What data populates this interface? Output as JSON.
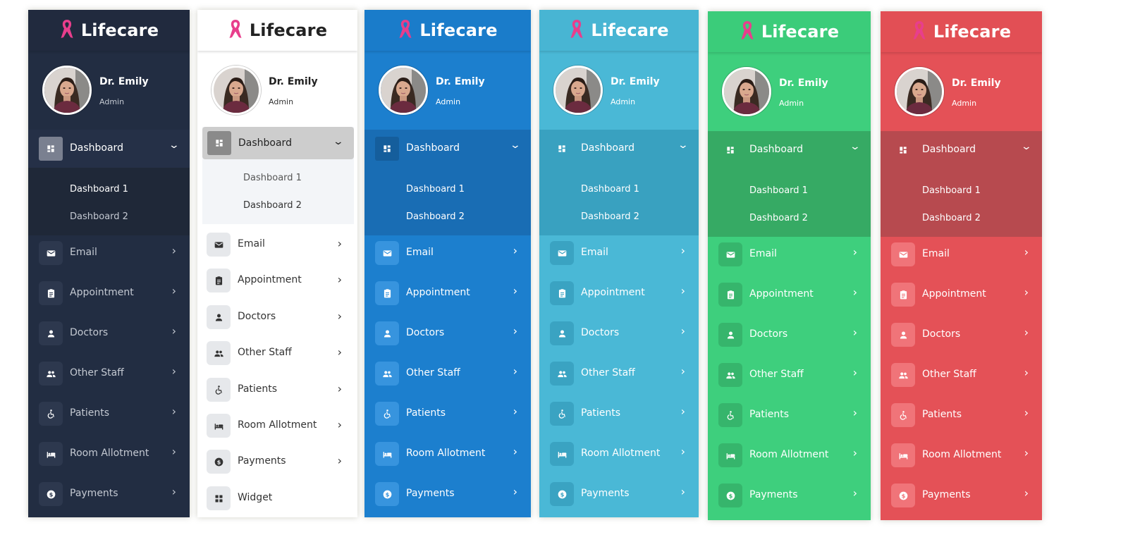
{
  "brand": "Lifecare",
  "user": {
    "name": "Dr. Emily",
    "role": "Admin"
  },
  "dashboard": {
    "label": "Dashboard",
    "subitems": [
      "Dashboard 1",
      "Dashboard 2"
    ]
  },
  "menu": [
    {
      "label": "Email",
      "icon": "email-icon"
    },
    {
      "label": "Appointment",
      "icon": "clipboard-icon"
    },
    {
      "label": "Doctors",
      "icon": "person-icon"
    },
    {
      "label": "Other Staff",
      "icon": "people-icon"
    },
    {
      "label": "Patients",
      "icon": "wheelchair-icon"
    },
    {
      "label": "Room Allotment",
      "icon": "bed-icon"
    },
    {
      "label": "Payments",
      "icon": "dollar-icon"
    },
    {
      "label": "Widget",
      "icon": "widget-icon"
    }
  ],
  "icons": {
    "ribbon": "ribbon-icon",
    "dashboard": "dashboard-grid-icon",
    "expand": "chevron-down-icon",
    "chevron": "chevron-right-icon"
  },
  "themes": [
    {
      "name": "dark",
      "bg": "#222d42",
      "header": "#212a3e",
      "sub": "#1f2838",
      "dashRow": "#253047",
      "dashIcon": "#7a8090",
      "iconBg": "#2d384e",
      "text": "#c4c9d2",
      "textStrong": "#ffffff",
      "brand": "#ffffff",
      "ribbon": "#e83e8c"
    },
    {
      "name": "light",
      "bg": "#ffffff",
      "header": "#ffffff",
      "sub": "#f3f5f8",
      "dashRow": "#cdcdcd",
      "dashIcon": "#8a8a8a",
      "iconBg": "#e6e8eb",
      "text": "#333333",
      "textStrong": "#222222",
      "brand": "#222222",
      "ribbon": "#e83e8c"
    },
    {
      "name": "blue",
      "bg": "#1c7fce",
      "header": "#1a7cca",
      "sub": "#196db4",
      "dashRow": "#196db4",
      "dashIcon": "#155e9c",
      "iconBg": "#3794de",
      "text": "#ffffff",
      "textStrong": "#ffffff",
      "brand": "#ffffff",
      "ribbon": "#e83e8c"
    },
    {
      "name": "cyan",
      "bg": "#4ab8d6",
      "header": "#48b5d3",
      "sub": "#39a1c0",
      "dashRow": "#39a1c0",
      "dashIcon": "#39a1c0",
      "iconBg": "#3aa3c2",
      "text": "#ffffff",
      "textStrong": "#ffffff",
      "brand": "#ffffff",
      "ribbon": "#e83e8c"
    },
    {
      "name": "green",
      "bg": "#3ecf7d",
      "header": "#3bcc7a",
      "sub": "#36aa64",
      "dashRow": "#36aa64",
      "dashIcon": "#36aa64",
      "iconBg": "#36b56c",
      "text": "#ffffff",
      "textStrong": "#ffffff",
      "brand": "#ffffff",
      "ribbon": "#e83e8c"
    },
    {
      "name": "red",
      "bg": "#e45157",
      "header": "#e24f55",
      "sub": "#b74a4f",
      "dashRow": "#b74a4f",
      "dashIcon": "#b74a4f",
      "iconBg": "#f07479",
      "text": "#ffffff",
      "textStrong": "#ffffff",
      "brand": "#ffffff",
      "ribbon": "#e83e8c"
    }
  ]
}
